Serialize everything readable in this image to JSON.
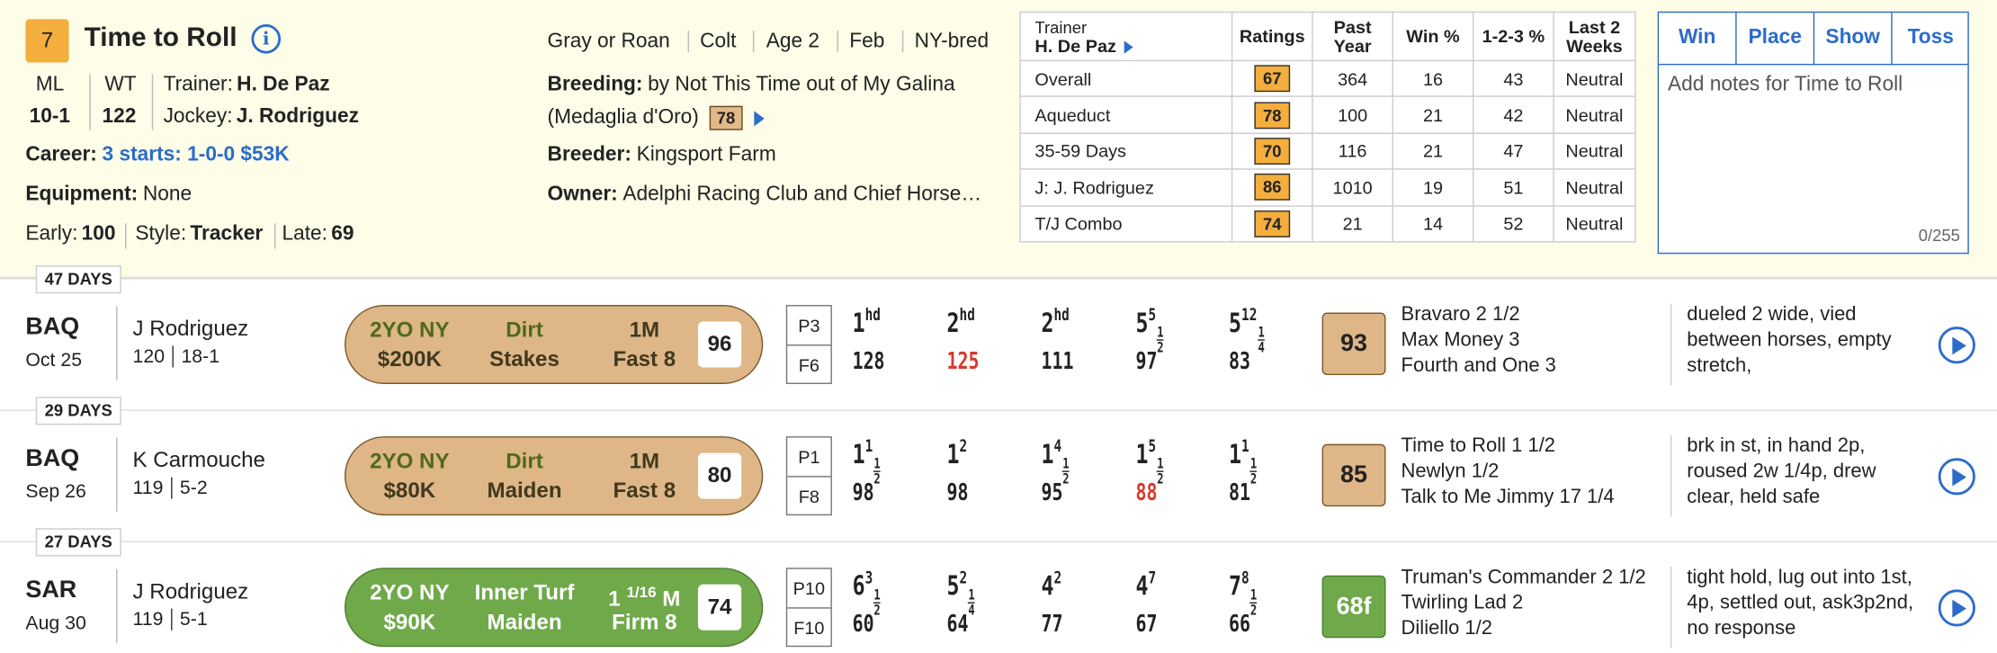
{
  "horse": {
    "pp": "7",
    "name": "Time to Roll",
    "ml_label": "ML",
    "ml": "10-1",
    "wt_label": "WT",
    "wt": "122",
    "trainer_label": "Trainer:",
    "trainer": "H. De Paz",
    "jockey_label": "Jockey:",
    "jockey": "J. Rodriguez",
    "career_label": "Career:",
    "career": "3 starts: 1-0-0 $53K",
    "equipment_label": "Equipment:",
    "equipment": "None",
    "early_label": "Early:",
    "early": "100",
    "style_label": "Style:",
    "style": "Tracker",
    "late_label": "Late:",
    "late": "69"
  },
  "details": {
    "tags": [
      "Gray or Roan",
      "Colt",
      "Age 2",
      "Feb",
      "NY-bred"
    ],
    "breeding_label": "Breeding:",
    "breeding": "by Not This Time out of My Galina",
    "breeding2": "(Medaglia d'Oro)",
    "breeding_rating": "78",
    "breeder_label": "Breeder:",
    "breeder": "Kingsport Farm",
    "owner_label": "Owner:",
    "owner": "Adelphi Racing Club and Chief Horse…"
  },
  "trainer_table": {
    "header_label": "Trainer",
    "header_name": "H. De Paz",
    "columns": [
      "Ratings",
      "Past Year",
      "Win %",
      "1-2-3 %",
      "Last 2 Weeks"
    ],
    "rows": [
      {
        "label": "Overall",
        "rating": "67",
        "past": "364",
        "win": "16",
        "itm": "43",
        "last2": "Neutral"
      },
      {
        "label": "Aqueduct",
        "rating": "78",
        "past": "100",
        "win": "21",
        "itm": "42",
        "last2": "Neutral"
      },
      {
        "label": "35-59 Days",
        "rating": "70",
        "past": "116",
        "win": "21",
        "itm": "47",
        "last2": "Neutral"
      },
      {
        "label": "J: J. Rodriguez",
        "rating": "86",
        "past": "1010",
        "win": "19",
        "itm": "51",
        "last2": "Neutral"
      },
      {
        "label": "T/J Combo",
        "rating": "74",
        "past": "21",
        "win": "14",
        "itm": "52",
        "last2": "Neutral"
      }
    ]
  },
  "bets": {
    "win": "Win",
    "place": "Place",
    "show": "Show",
    "toss": "Toss",
    "notes_placeholder": "Add notes for Time to Roll",
    "count": "0/255"
  },
  "races": [
    {
      "days": "47 DAYS",
      "track": "BAQ",
      "date": "Oct 25",
      "jockey": "J Rodriguez",
      "weight": "120",
      "odds": "18-1",
      "class1": "2YO NY",
      "class2": "$200K",
      "surface1": "Dirt",
      "surface2": "Stakes",
      "dist1": "1M",
      "dist2": "Fast 8",
      "dist_frac": "",
      "speed": "96",
      "post": "P3",
      "field": "F6",
      "calls": [
        {
          "pos": "1",
          "lead": "hd"
        },
        {
          "pos": "2",
          "lead": "hd"
        },
        {
          "pos": "2",
          "lead": "hd"
        },
        {
          "pos": "5",
          "lead": "5"
        },
        {
          "pos": "5",
          "lead": "12"
        }
      ],
      "figs": [
        "128",
        "125",
        "111",
        "97",
        "83"
      ],
      "bsf": "93",
      "finishers": [
        "Bravaro  2 1/2",
        "Max Money  3",
        "Fourth and One  3"
      ],
      "comment": [
        "dueled 2 wide, vied",
        "between horses, empty",
        "stretch,"
      ]
    },
    {
      "days": "29 DAYS",
      "track": "BAQ",
      "date": "Sep 26",
      "jockey": "K Carmouche",
      "weight": "119",
      "odds": "5-2",
      "class1": "2YO NY",
      "class2": "$80K",
      "surface1": "Dirt",
      "surface2": "Maiden",
      "dist1": "1M",
      "dist2": "Fast 8",
      "dist_frac": "",
      "speed": "80",
      "post": "P1",
      "field": "F8",
      "calls": [
        {
          "pos": "1",
          "lead": "1"
        },
        {
          "pos": "1",
          "lead": "2"
        },
        {
          "pos": "1",
          "lead": "4"
        },
        {
          "pos": "1",
          "lead": "5"
        },
        {
          "pos": "1",
          "lead": "1"
        }
      ],
      "figs": [
        "98",
        "98",
        "95",
        "88",
        "81"
      ],
      "bsf": "85",
      "finishers": [
        "Time to Roll  1 1/2",
        "Newlyn  1/2",
        "Talk to Me Jimmy  17 1/4"
      ],
      "comment": [
        "brk in st, in hand 2p,",
        "roused 2w 1/4p, drew",
        "clear, held safe"
      ]
    },
    {
      "days": "27 DAYS",
      "track": "SAR",
      "date": "Aug 30",
      "jockey": "J Rodriguez",
      "weight": "119",
      "odds": "5-1",
      "class1": "2YO NY",
      "class2": "$90K",
      "surface1": "Inner Turf",
      "surface2": "Maiden",
      "dist1": "1",
      "dist2": "Firm 8",
      "dist_frac": "1/16",
      "dist_unit": "M",
      "speed": "74",
      "post": "P10",
      "field": "F10",
      "calls": [
        {
          "pos": "6",
          "lead": "3"
        },
        {
          "pos": "5",
          "lead": "2"
        },
        {
          "pos": "4",
          "lead": "2"
        },
        {
          "pos": "4",
          "lead": "7"
        },
        {
          "pos": "7",
          "lead": "8"
        }
      ],
      "figs": [
        "60",
        "64",
        "77",
        "67",
        "66"
      ],
      "bsf": "68f",
      "finishers": [
        "Truman's Commander  2 1/2",
        "Twirling Lad  2",
        "Diliello  1/2"
      ],
      "comment": [
        "tight hold, lug out into 1st,",
        "4p, settled out, ask3p2nd,",
        "no response"
      ]
    }
  ]
}
